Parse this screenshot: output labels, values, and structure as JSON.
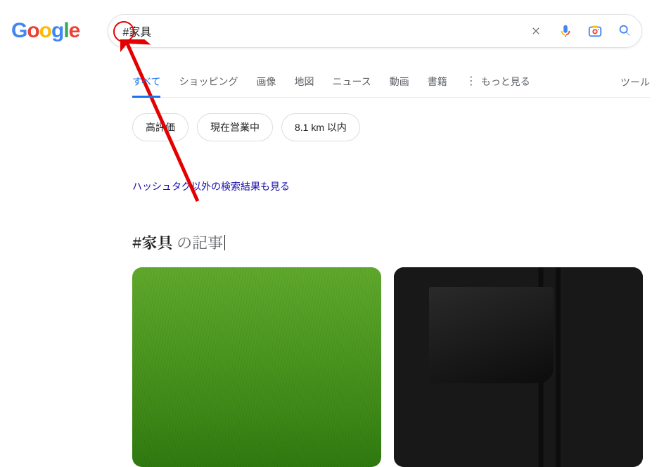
{
  "search": {
    "query": "#家具"
  },
  "tabs": {
    "items": [
      {
        "label": "すべて",
        "active": true
      },
      {
        "label": "ショッピング"
      },
      {
        "label": "画像"
      },
      {
        "label": "地図"
      },
      {
        "label": "ニュース"
      },
      {
        "label": "動画"
      },
      {
        "label": "書籍"
      }
    ],
    "more": "もっと見る",
    "tools": "ツール"
  },
  "chips": [
    "高評価",
    "現在営業中",
    "8.1 km 以内"
  ],
  "hashtag_results_link": "ハッシュタグ以外の検索結果も見る",
  "section": {
    "bold": "#家具",
    "rest": " の記事"
  }
}
